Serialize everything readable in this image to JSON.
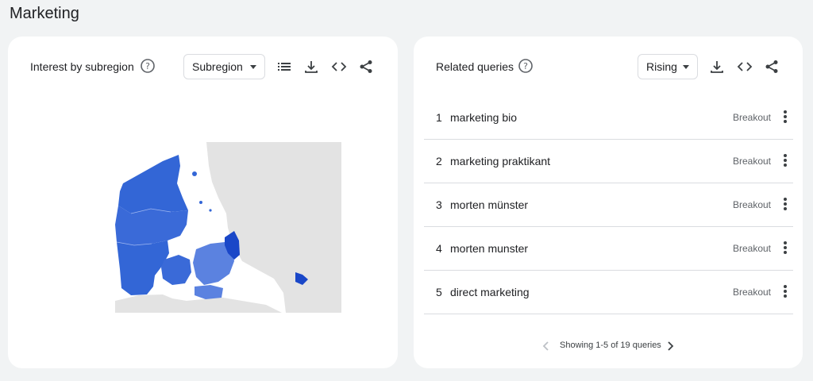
{
  "page_title": "Marketing",
  "left_card": {
    "title": "Interest by subregion",
    "dropdown_value": "Subregion",
    "icons": [
      "help-icon",
      "list-icon",
      "download-icon",
      "embed-icon",
      "share-icon"
    ]
  },
  "right_card": {
    "title": "Related queries",
    "dropdown_value": "Rising",
    "icons": [
      "help-icon",
      "download-icon",
      "embed-icon",
      "share-icon"
    ],
    "rows": [
      {
        "rank": "1",
        "query": "marketing bio",
        "value": "Breakout"
      },
      {
        "rank": "2",
        "query": "marketing praktikant",
        "value": "Breakout"
      },
      {
        "rank": "3",
        "query": "morten münster",
        "value": "Breakout"
      },
      {
        "rank": "4",
        "query": "morten munster",
        "value": "Breakout"
      },
      {
        "rank": "5",
        "query": "direct marketing",
        "value": "Breakout"
      }
    ],
    "pagination": "Showing 1-5 of 19 queries"
  },
  "colors": {
    "map_high": "#1a47c8",
    "map_mid": "#3366d6",
    "map_low": "#5b82e0",
    "map_land": "#e3e3e3",
    "icon": "#3c4043"
  }
}
